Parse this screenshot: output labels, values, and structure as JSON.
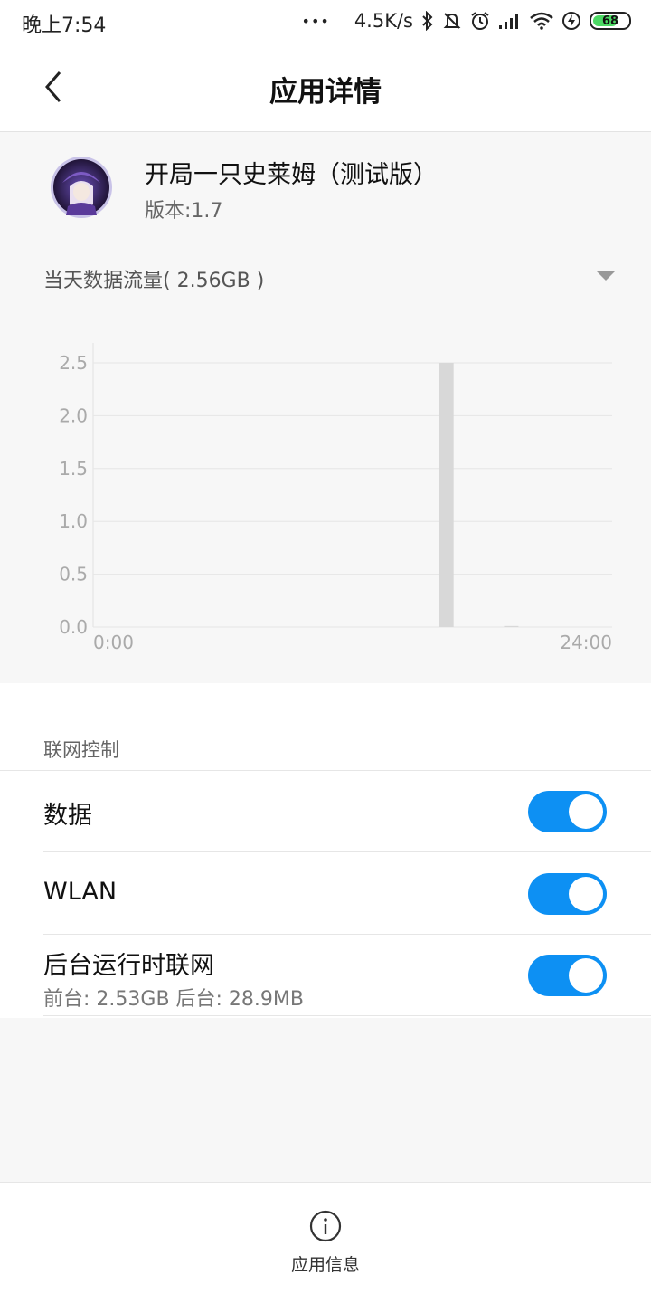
{
  "statusbar": {
    "time": "晚上7:54",
    "dots": "•••",
    "speed": "4.5K/s",
    "battery": "68",
    "icons": [
      "bluetooth-icon",
      "mute-icon",
      "alarm-icon",
      "signal-icon",
      "wifi-icon",
      "charging-icon",
      "battery-icon"
    ]
  },
  "header": {
    "title": "应用详情"
  },
  "app": {
    "name": "开局一只史莱姆（测试版）",
    "version": "版本:1.7"
  },
  "usage": {
    "label": "当天数据流量( 2.56GB )"
  },
  "chart_data": {
    "type": "bar",
    "x_range": [
      "0:00",
      "24:00"
    ],
    "xtick_labels": [
      "0:00",
      "24:00"
    ],
    "yticks": [
      0.0,
      0.5,
      1.0,
      1.5,
      2.0,
      2.5
    ],
    "ytick_labels": [
      "0.0",
      "0.5",
      "1.0",
      "1.5",
      "2.0",
      "2.5"
    ],
    "ylim": [
      0,
      2.5
    ],
    "grid": true,
    "bars": [
      {
        "hour": 16,
        "value": 2.5
      },
      {
        "hour": 19,
        "value": 0.01
      }
    ],
    "bar_color": "#d8d8d8"
  },
  "network": {
    "section_title": "联网控制",
    "rows": [
      {
        "title": "数据",
        "subtitle": "",
        "enabled": true
      },
      {
        "title": "WLAN",
        "subtitle": "",
        "enabled": true
      },
      {
        "title": "后台运行时联网",
        "subtitle": "前台: 2.53GB  后台: 28.9MB",
        "enabled": true
      }
    ],
    "toggle_color": "#0d90f3"
  },
  "bottom": {
    "label": "应用信息"
  }
}
